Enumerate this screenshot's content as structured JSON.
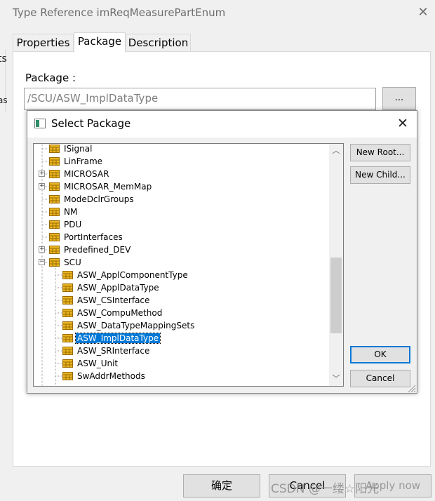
{
  "outer_dialog": {
    "title": "Type Reference imReqMeasurePartEnum",
    "left_edge_fragments": [
      "ts",
      "as"
    ],
    "tabs": [
      {
        "label": "Properties",
        "active": false
      },
      {
        "label": "Package",
        "active": true
      },
      {
        "label": "Description",
        "active": false
      }
    ],
    "package_label": "Package :",
    "package_value": "/SCU/ASW_ImplDataType",
    "browse_label": "...",
    "confirm_label": "确定",
    "cancel_label": "Cancel",
    "apply_label": "Apply now",
    "watermark": "CSDN @一缕☆阳光"
  },
  "select_package_dialog": {
    "title": "Select Package",
    "tree_items": [
      {
        "label": "ISignal",
        "level": 0,
        "expander": "none",
        "selected": false
      },
      {
        "label": "LinFrame",
        "level": 0,
        "expander": "none",
        "selected": false
      },
      {
        "label": "MICROSAR",
        "level": 0,
        "expander": "plus",
        "selected": false
      },
      {
        "label": "MICROSAR_MemMap",
        "level": 0,
        "expander": "plus",
        "selected": false
      },
      {
        "label": "ModeDclrGroups",
        "level": 0,
        "expander": "none",
        "selected": false
      },
      {
        "label": "NM",
        "level": 0,
        "expander": "none",
        "selected": false
      },
      {
        "label": "PDU",
        "level": 0,
        "expander": "none",
        "selected": false
      },
      {
        "label": "PortInterfaces",
        "level": 0,
        "expander": "none",
        "selected": false
      },
      {
        "label": "Predefined_DEV",
        "level": 0,
        "expander": "plus",
        "selected": false
      },
      {
        "label": "SCU",
        "level": 0,
        "expander": "minus",
        "selected": false
      },
      {
        "label": "ASW_ApplComponentType",
        "level": 1,
        "expander": "none",
        "selected": false
      },
      {
        "label": "ASW_ApplDataType",
        "level": 1,
        "expander": "none",
        "selected": false
      },
      {
        "label": "ASW_CSInterface",
        "level": 1,
        "expander": "none",
        "selected": false
      },
      {
        "label": "ASW_CompuMethod",
        "level": 1,
        "expander": "none",
        "selected": false
      },
      {
        "label": "ASW_DataTypeMappingSets",
        "level": 1,
        "expander": "none",
        "selected": false
      },
      {
        "label": "ASW_ImplDataType",
        "level": 1,
        "expander": "none",
        "selected": true
      },
      {
        "label": "ASW_SRInterface",
        "level": 1,
        "expander": "none",
        "selected": false
      },
      {
        "label": "ASW_Unit",
        "level": 1,
        "expander": "none",
        "selected": false
      },
      {
        "label": "SwAddrMethods",
        "level": 1,
        "expander": "none",
        "selected": false
      }
    ],
    "new_root_label": "New Root...",
    "new_child_label": "New Child...",
    "ok_label": "OK",
    "cancel_label": "Cancel"
  },
  "colors": {
    "selection": "#0078d7",
    "package_icon": "#e8b422",
    "package_icon_border": "#9a6b00"
  },
  "icons": {
    "close": "close-icon",
    "package": "package-icon",
    "scroll_up": "chevron-up-icon",
    "scroll_down": "chevron-down-icon"
  }
}
